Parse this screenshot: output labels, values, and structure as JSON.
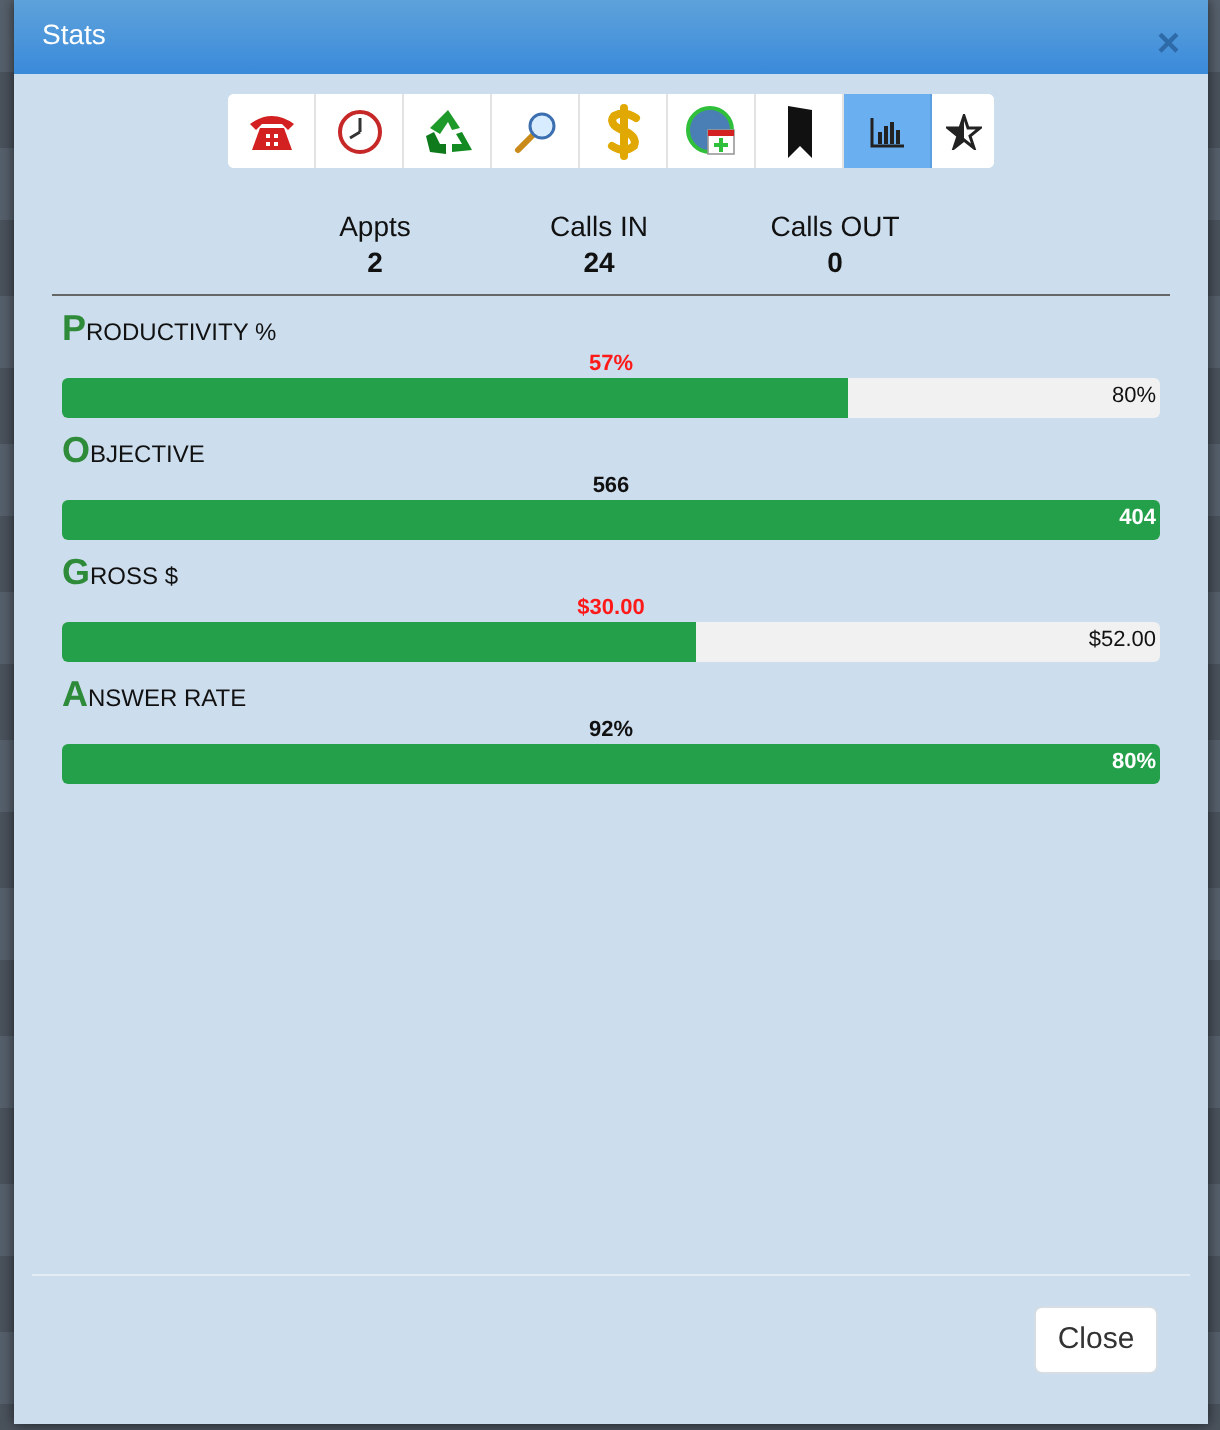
{
  "dialog": {
    "title": "Stats",
    "close_glyph": "×"
  },
  "toolbar": [
    {
      "kind": "phone",
      "selected": false
    },
    {
      "kind": "clock",
      "selected": false
    },
    {
      "kind": "recycle",
      "selected": false
    },
    {
      "kind": "magnifier",
      "selected": false
    },
    {
      "kind": "dollar",
      "selected": false
    },
    {
      "kind": "calendar",
      "selected": false
    },
    {
      "kind": "bookmark",
      "selected": false
    },
    {
      "kind": "chart",
      "selected": true
    },
    {
      "kind": "star",
      "selected": false
    }
  ],
  "counters": [
    {
      "label": "Appts",
      "value": "2"
    },
    {
      "label": "Calls IN",
      "value": "24"
    },
    {
      "label": "Calls OUT",
      "value": "0"
    }
  ],
  "metrics": [
    {
      "label": "PRODUCTIVITY %",
      "value": "57%",
      "on_target": false,
      "level": 0.715,
      "target": "80%"
    },
    {
      "label": "OBJECTIVE",
      "value": "566",
      "on_target": true,
      "level": 1,
      "target": "404"
    },
    {
      "label": "GROSS $",
      "value": "$30.00",
      "on_target": false,
      "level": 0.577,
      "target": "$52.00"
    },
    {
      "label": "ANSWER RATE",
      "value": "92%",
      "on_target": true,
      "level": 1,
      "target": "80%"
    }
  ],
  "footer": {
    "close_button": "Close"
  }
}
